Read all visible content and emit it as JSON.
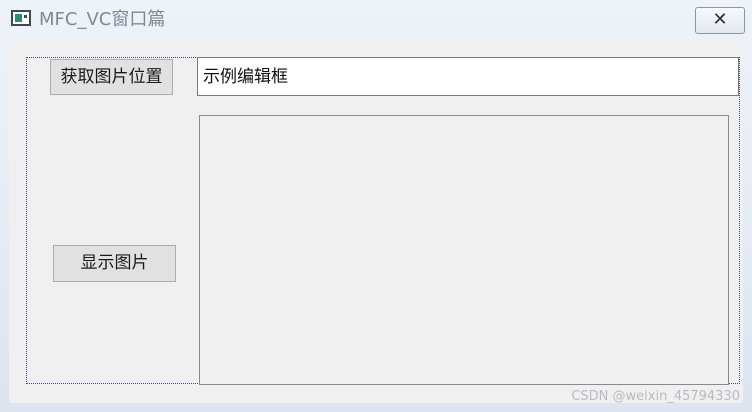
{
  "window": {
    "title": "MFC_VC窗口篇",
    "close_glyph": "✕"
  },
  "dialog": {
    "get_image_button_label": "获取图片位置",
    "show_image_button_label": "显示图片",
    "edit_box_text": "示例编辑框"
  },
  "watermark": "CSDN @weixin_45794330",
  "icons": {
    "app": "app-window-icon",
    "close": "close-icon"
  },
  "colors": {
    "title_text": "#7f8a95",
    "client_background": "#f0f0f0",
    "button_face": "#e1e1e1",
    "edit_background": "#ffffff",
    "frame_dotted": "#2d4f8a"
  }
}
